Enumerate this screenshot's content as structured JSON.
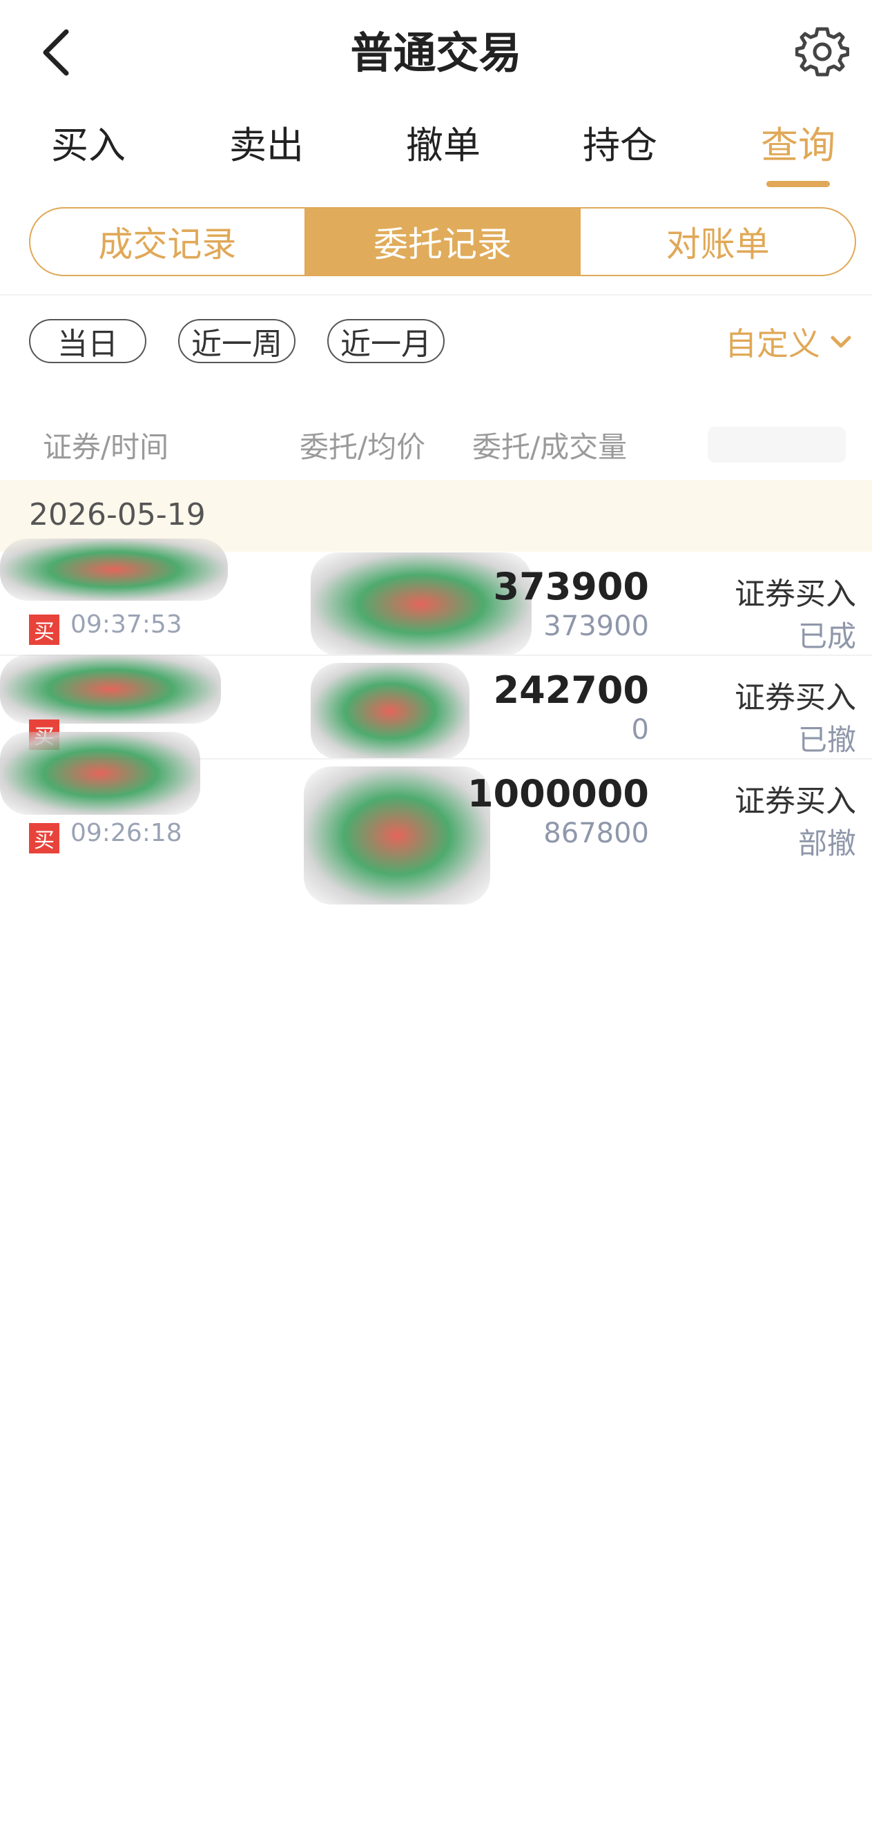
{
  "header": {
    "title": "普通交易",
    "back_icon": "chevron-left-icon",
    "settings_icon": "gear-icon"
  },
  "tabs": [
    {
      "label": "买入",
      "active": false
    },
    {
      "label": "卖出",
      "active": false
    },
    {
      "label": "撤单",
      "active": false
    },
    {
      "label": "持仓",
      "active": false
    },
    {
      "label": "查询",
      "active": true
    }
  ],
  "segment": [
    {
      "label": "成交记录",
      "active": false
    },
    {
      "label": "委托记录",
      "active": true
    },
    {
      "label": "对账单",
      "active": false
    }
  ],
  "filters": {
    "chips": [
      "当日",
      "近一周",
      "近一月"
    ],
    "custom_label": "自定义"
  },
  "columns": {
    "security_time": "证券/时间",
    "price": "委托/均价",
    "volume": "委托/成交量"
  },
  "date": "2026-05-19",
  "orders": [
    {
      "badge": "买",
      "time": "09:37:53",
      "order_qty": "373900",
      "filled_qty": "373900",
      "type": "证券买入",
      "status": "已成"
    },
    {
      "badge": "买",
      "time": "",
      "order_qty": "242700",
      "filled_qty": "0",
      "type": "证券买入",
      "status": "已撤"
    },
    {
      "badge": "买",
      "time": "09:26:18",
      "order_qty": "1000000",
      "filled_qty": "867800",
      "type": "证券买入",
      "status": "部撤"
    }
  ],
  "colors": {
    "accent": "#e0a857",
    "buy_badge": "#e8433a",
    "date_band": "#fdf8ec"
  }
}
